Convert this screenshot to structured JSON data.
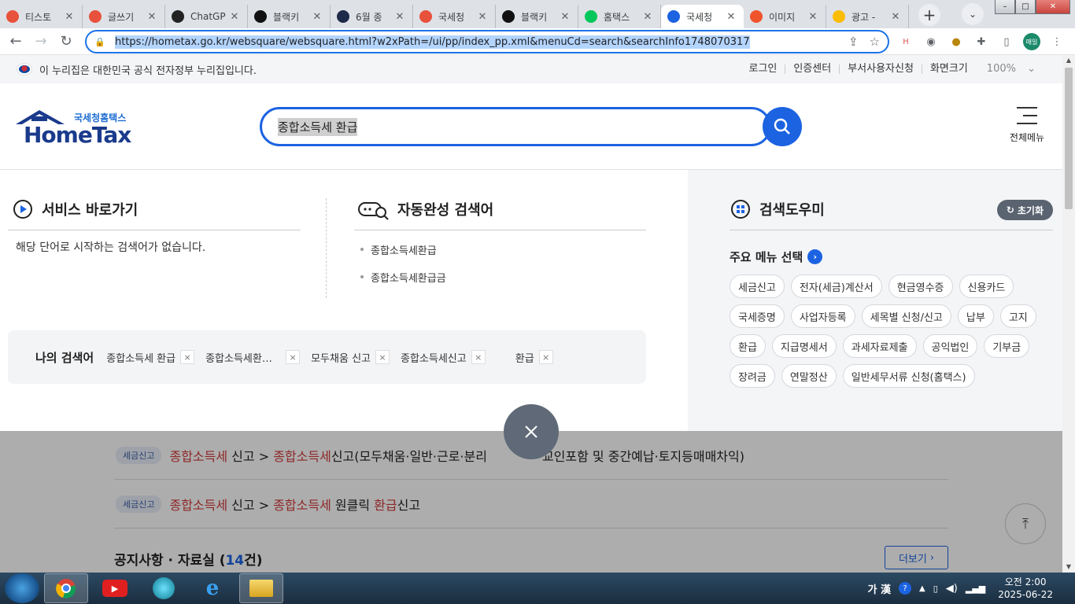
{
  "browser": {
    "tabs": [
      {
        "title": "티스토",
        "color": "#e8513c",
        "active": false
      },
      {
        "title": "글쓰기",
        "color": "#e8513c",
        "active": false
      },
      {
        "title": "ChatGP",
        "color": "#222222",
        "active": false
      },
      {
        "title": "블랙키",
        "color": "#111111",
        "active": false
      },
      {
        "title": "6월 종",
        "color": "#1e2a4a",
        "active": false
      },
      {
        "title": "국세청",
        "color": "#e8513c",
        "active": false
      },
      {
        "title": "블랙키",
        "color": "#111111",
        "active": false
      },
      {
        "title": "홈택스",
        "color": "#03c75a",
        "active": false
      },
      {
        "title": "국세청",
        "color": "#1c63e2",
        "active": true
      },
      {
        "title": "이미지",
        "color": "#f0542d",
        "active": false
      },
      {
        "title": "광고 -",
        "color": "#fbbc04",
        "active": false
      }
    ],
    "url": "https://hometax.go.kr/websquare/websquare.html?w2xPath=/ui/pp/index_pp.xml&menuCd=search&searchInfo1748070317",
    "profile_label": "매일"
  },
  "gov_bar": {
    "text": "이 누리집은 대한민국 공식 전자정부 누리집입니다.",
    "links": [
      "로그인",
      "인증센터",
      "부서사용자신청",
      "화면크기"
    ],
    "zoom": "100%"
  },
  "header": {
    "logo_sub": "국세청홈택스",
    "logo_main": "HomeTax",
    "search_query": "종합소득세 환급",
    "menu_label": "전체메뉴"
  },
  "dropdown": {
    "service_title": "서비스 바로가기",
    "no_result": "해당 단어로 시작하는 검색어가 없습니다.",
    "auto_title": "자동완성 검색어",
    "auto_items": [
      "종합소득세환급",
      "종합소득세환급금"
    ],
    "my_search_title": "나의 검색어",
    "my_keywords": [
      "종합소득세 환급",
      "종합소득세환…",
      "모두채움 신고",
      "종합소득세신고",
      "환급"
    ],
    "helper_title": "검색도우미",
    "reset_label": "초기화",
    "main_menu_title": "주요 메뉴 선택",
    "chips": [
      "세금신고",
      "전자(세금)계산서",
      "현금영수증",
      "신용카드",
      "국세증명",
      "사업자등록",
      "세목별 신청/신고",
      "납부",
      "고지",
      "환급",
      "지급명세서",
      "과세자료제출",
      "공익법인",
      "기부금",
      "장려금",
      "연말정산",
      "일반세무서류 신청(홈택스)"
    ]
  },
  "results": {
    "row1": {
      "badge": "세금신고",
      "hl1": "종합소득세",
      "t1": " 신고 > ",
      "hl2": "종합소득세",
      "t2": "신고(모두채움·일반·근로·분리",
      "t3": "교인포함 및 중간예납·토지등매매차익)"
    },
    "row2": {
      "badge": "세금신고",
      "hl1": "종합소득세",
      "t1": " 신고 > ",
      "hl2": "종합소득세",
      "t2": " 원클릭 ",
      "hl3": "환급",
      "t3": "신고"
    },
    "notice_title": "공지사항 · 자료실 (",
    "notice_count": "14",
    "notice_suffix": "건)",
    "more_label": "더보기"
  },
  "taskbar": {
    "ime": "가 漢",
    "time": "오전 2:00",
    "date": "2025-06-22"
  }
}
